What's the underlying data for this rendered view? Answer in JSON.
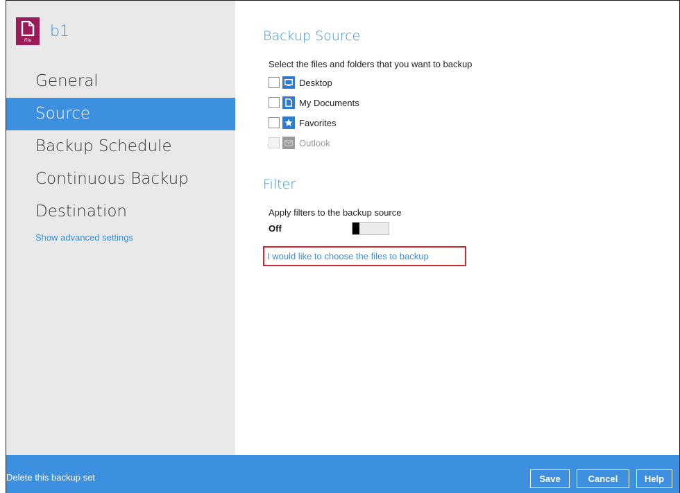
{
  "sidebar": {
    "set_name": "b1",
    "set_icon": "file-icon",
    "set_icon_label": "File",
    "items": [
      {
        "label": "General",
        "active": false
      },
      {
        "label": "Source",
        "active": true
      },
      {
        "label": "Backup Schedule",
        "active": false
      },
      {
        "label": "Continuous Backup",
        "active": false
      },
      {
        "label": "Destination",
        "active": false
      }
    ],
    "advanced_link": "Show advanced settings"
  },
  "source": {
    "title": "Backup Source",
    "description": "Select the files and folders that you want to backup",
    "items": [
      {
        "label": "Desktop",
        "icon": "desktop-icon",
        "checked": false,
        "enabled": true
      },
      {
        "label": "My Documents",
        "icon": "document-icon",
        "checked": false,
        "enabled": true
      },
      {
        "label": "Favorites",
        "icon": "star-icon",
        "checked": false,
        "enabled": true
      },
      {
        "label": "Outlook",
        "icon": "mail-icon",
        "checked": false,
        "enabled": false
      }
    ]
  },
  "filter": {
    "title": "Filter",
    "description": "Apply filters to the backup source",
    "state_label": "Off"
  },
  "choose_link": "I would like to choose the files to backup",
  "footer": {
    "delete_link": "Delete this backup set",
    "save": "Save",
    "cancel": "Cancel",
    "help": "Help"
  },
  "colors": {
    "accent": "#3d8fe0",
    "brand": "#9b1b5a",
    "highlight": "#d0262d",
    "sidebar_bg": "#e9e9e9"
  }
}
